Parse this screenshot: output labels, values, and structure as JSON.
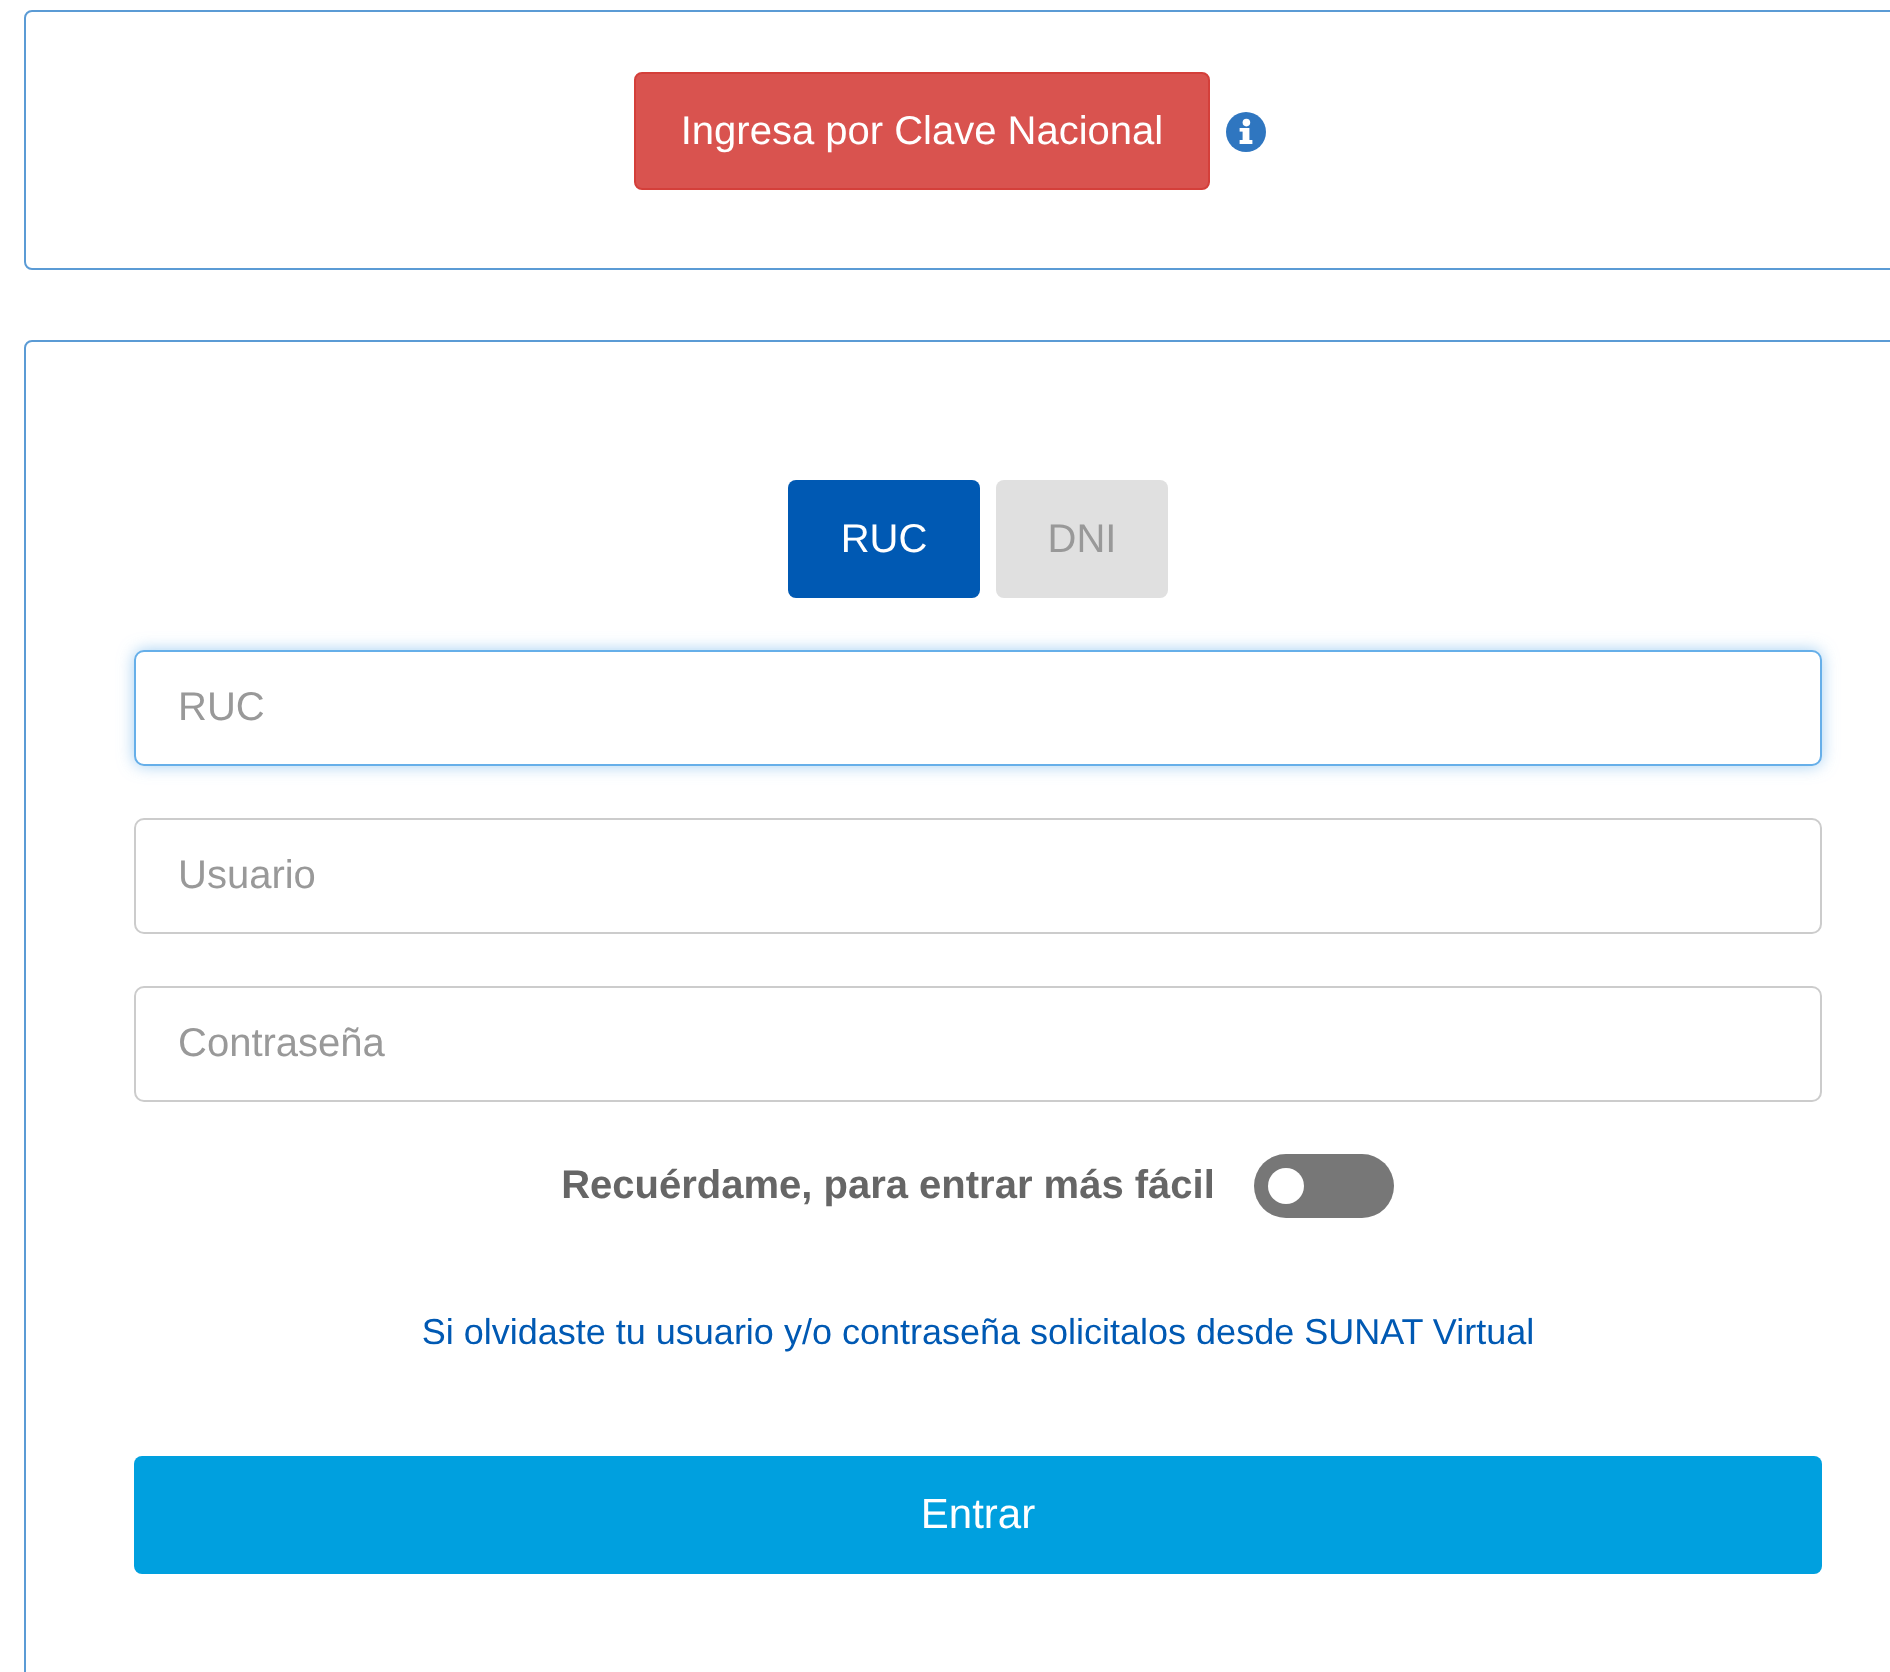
{
  "national_key": {
    "button": "Ingresa por Clave Nacional"
  },
  "tabs": [
    {
      "label": "RUC",
      "selected": true
    },
    {
      "label": "DNI",
      "selected": false
    }
  ],
  "fields": [
    {
      "placeholder": "RUC",
      "focused": true
    },
    {
      "placeholder": "Usuario",
      "focused": false
    },
    {
      "placeholder": "Contraseña",
      "focused": false
    }
  ],
  "remember": {
    "label": "Recuérdame, para entrar más fácil",
    "on": false
  },
  "forgot_link": "Si olvidaste tu usuario y/o contraseña solicitalos desde SUNAT Virtual",
  "submit": "Entrar"
}
